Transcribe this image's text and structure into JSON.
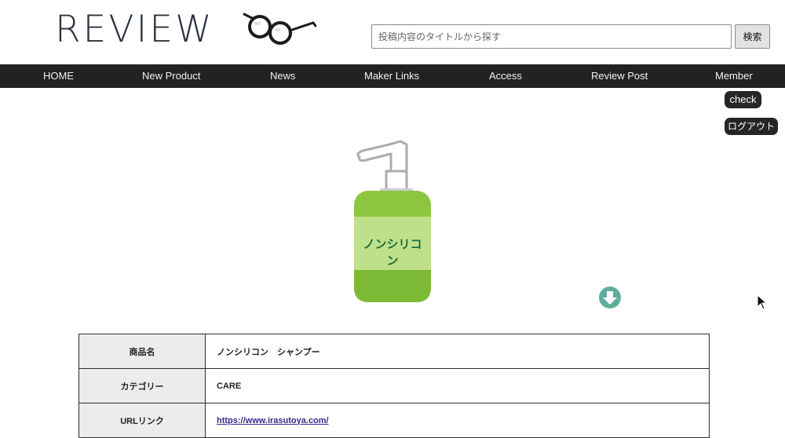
{
  "header": {
    "logo_text": "REVIEW",
    "search": {
      "placeholder": "投稿内容のタイトルから探す",
      "value": ""
    },
    "search_button": "検索"
  },
  "nav": [
    {
      "label": "HOME"
    },
    {
      "label": "New Product"
    },
    {
      "label": "News"
    },
    {
      "label": "Maker Links"
    },
    {
      "label": "Access"
    },
    {
      "label": "Review Post"
    },
    {
      "label": "Member"
    }
  ],
  "side_buttons": {
    "check": "check",
    "logout": "ログアウト"
  },
  "product_image": {
    "label_text": "ノンシリコン",
    "icon": "shampoo-bottle"
  },
  "details": {
    "rows": [
      {
        "key": "商品名",
        "value": "ノンシリコン　シャンプー"
      },
      {
        "key": "カテゴリー",
        "value": "CARE"
      },
      {
        "key": "URLリンク",
        "value": "https://www.irasutoya.com/",
        "is_link": true
      }
    ]
  },
  "colors": {
    "nav_bg": "#222222",
    "bottle_green": "#8cc63f",
    "accent_teal": "#5fae9d"
  }
}
